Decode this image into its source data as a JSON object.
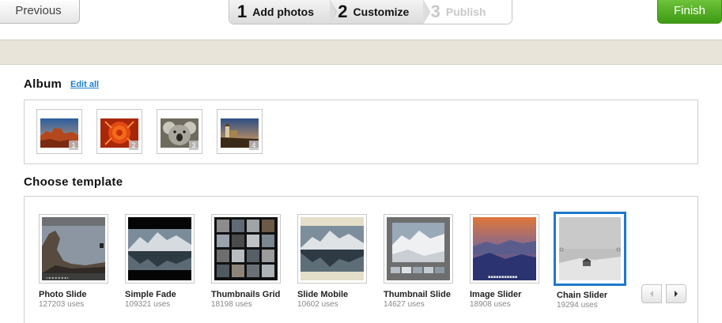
{
  "toolbar": {
    "previous_label": "Previous",
    "finish_label": "Finish",
    "steps": [
      {
        "num": "1",
        "label": "Add photos"
      },
      {
        "num": "2",
        "label": "Customize"
      },
      {
        "num": "3",
        "label": "Publish"
      }
    ]
  },
  "album": {
    "title": "Album",
    "edit_label": "Edit all",
    "photos": [
      {
        "index": "1",
        "icon": "desert-canyon-photo"
      },
      {
        "index": "2",
        "icon": "red-flower-photo"
      },
      {
        "index": "3",
        "icon": "koala-photo"
      },
      {
        "index": "4",
        "icon": "lighthouse-photo"
      }
    ]
  },
  "templates": {
    "title": "Choose template",
    "items": [
      {
        "name": "Photo Slide",
        "uses": "127203 uses"
      },
      {
        "name": "Simple Fade",
        "uses": "109321 uses"
      },
      {
        "name": "Thumbnails Grid",
        "uses": "18198 uses"
      },
      {
        "name": "Slide Mobile",
        "uses": "10602 uses"
      },
      {
        "name": "Thumbnail Slide",
        "uses": "14627 uses"
      },
      {
        "name": "Image Slider",
        "uses": "18908 uses"
      },
      {
        "name": "Chain Slider",
        "uses": "19294 uses"
      }
    ],
    "selected": "Chain Slider"
  },
  "colors": {
    "accent": "#1f78d0",
    "finish": "#4ea823",
    "band": "#e8e4da"
  }
}
